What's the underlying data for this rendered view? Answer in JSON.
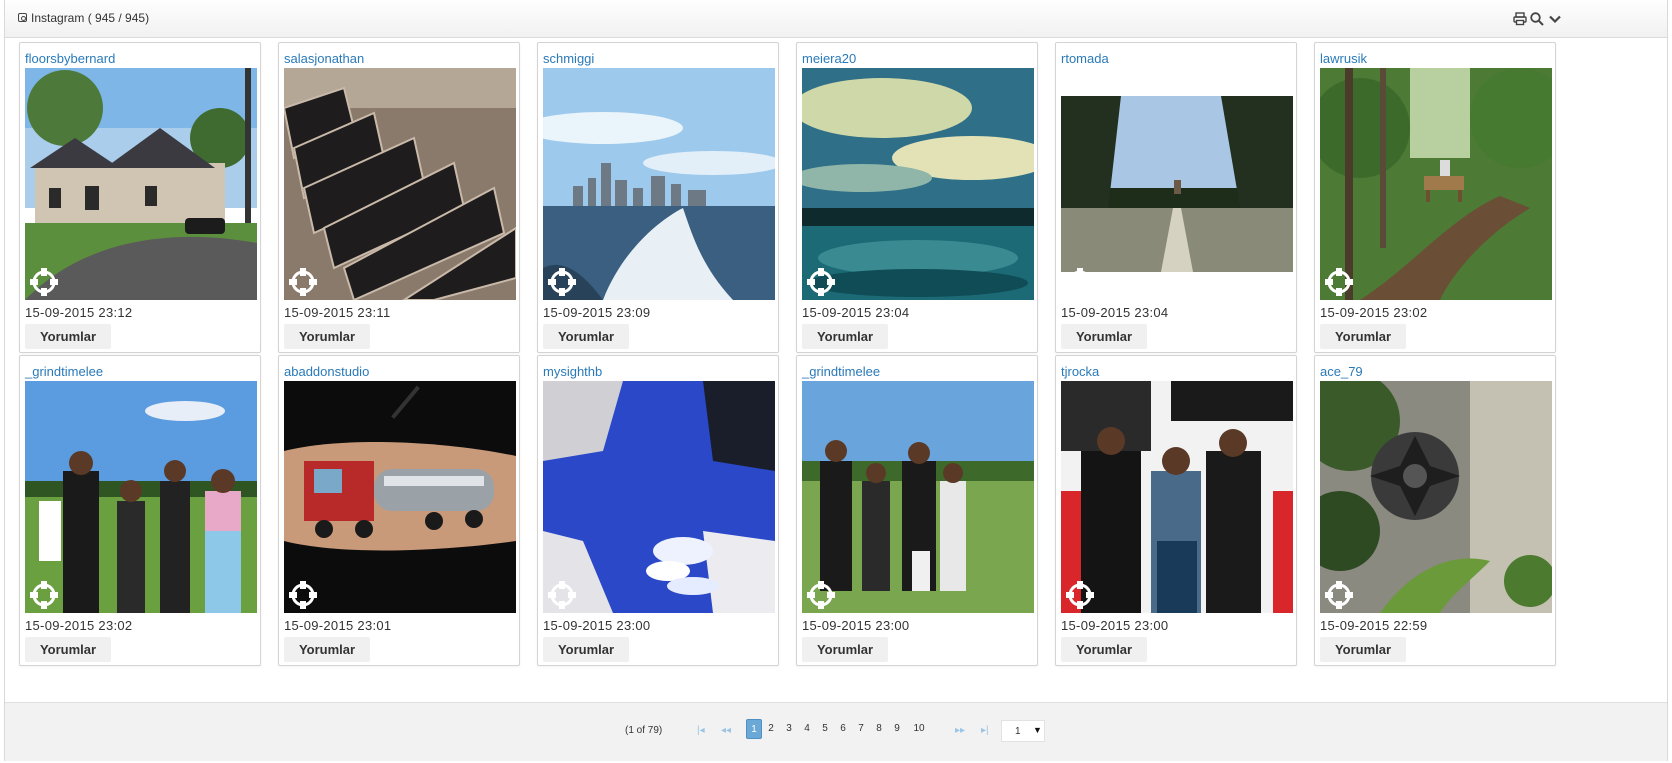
{
  "window": {
    "title": "Instagram ( 945 / 945)"
  },
  "toolbar": {
    "print_icon": "print-icon",
    "search_icon": "search-icon",
    "collapse_icon": "chevron-down-icon"
  },
  "posts": [
    {
      "user": "floorsbybernard",
      "time": "15-09-2015 23:12",
      "button": "Yorumlar"
    },
    {
      "user": "salasjonathan",
      "time": "15-09-2015 23:11",
      "button": "Yorumlar"
    },
    {
      "user": "schmiggi",
      "time": "15-09-2015 23:09",
      "button": "Yorumlar"
    },
    {
      "user": "meiera20",
      "time": "15-09-2015 23:04",
      "button": "Yorumlar"
    },
    {
      "user": "rtomada",
      "time": "15-09-2015 23:04",
      "button": "Yorumlar"
    },
    {
      "user": "lawrusik",
      "time": "15-09-2015 23:02",
      "button": "Yorumlar"
    },
    {
      "user": "_grindtimelee",
      "time": "15-09-2015 23:02",
      "button": "Yorumlar"
    },
    {
      "user": "abaddonstudio",
      "time": "15-09-2015 23:01",
      "button": "Yorumlar"
    },
    {
      "user": "mysighthb",
      "time": "15-09-2015 23:00",
      "button": "Yorumlar"
    },
    {
      "user": "_grindtimelee",
      "time": "15-09-2015 23:00",
      "button": "Yorumlar"
    },
    {
      "user": "tjrocka",
      "time": "15-09-2015 23:00",
      "button": "Yorumlar"
    },
    {
      "user": "ace_79",
      "time": "15-09-2015 22:59",
      "button": "Yorumlar"
    }
  ],
  "paginator": {
    "info": "(1 of 79)",
    "first": "|◂",
    "prev": "◂◂",
    "pages": [
      "1",
      "2",
      "3",
      "4",
      "5",
      "6",
      "7",
      "8",
      "9",
      "10"
    ],
    "current": "1",
    "next": "▸▸",
    "last": "▸|",
    "rows_select": "1",
    "select_arrow": "▼"
  }
}
